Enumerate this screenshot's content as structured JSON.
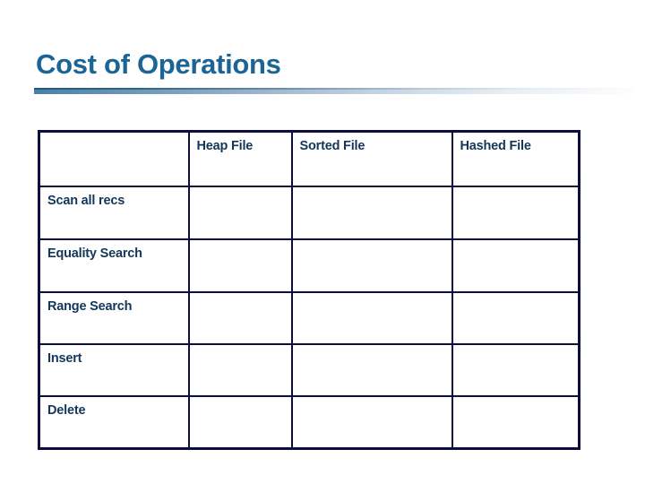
{
  "slide": {
    "title": "Cost of Operations",
    "background_color": "#ffffff",
    "title_color": "#1a6496",
    "table_border_color": "#0d0d42",
    "table_text_color": "#143659"
  },
  "table": {
    "corner_header": "",
    "column_headers": [
      "Heap File",
      "Sorted File",
      "Hashed File"
    ],
    "rows": [
      {
        "label": "Scan all recs",
        "cells": [
          "",
          "",
          ""
        ]
      },
      {
        "label": "Equality Search",
        "cells": [
          "",
          "",
          ""
        ]
      },
      {
        "label": "Range Search",
        "cells": [
          "",
          "",
          ""
        ]
      },
      {
        "label": "Insert",
        "cells": [
          "",
          "",
          ""
        ]
      },
      {
        "label": "Delete",
        "cells": [
          "",
          "",
          ""
        ]
      }
    ]
  }
}
